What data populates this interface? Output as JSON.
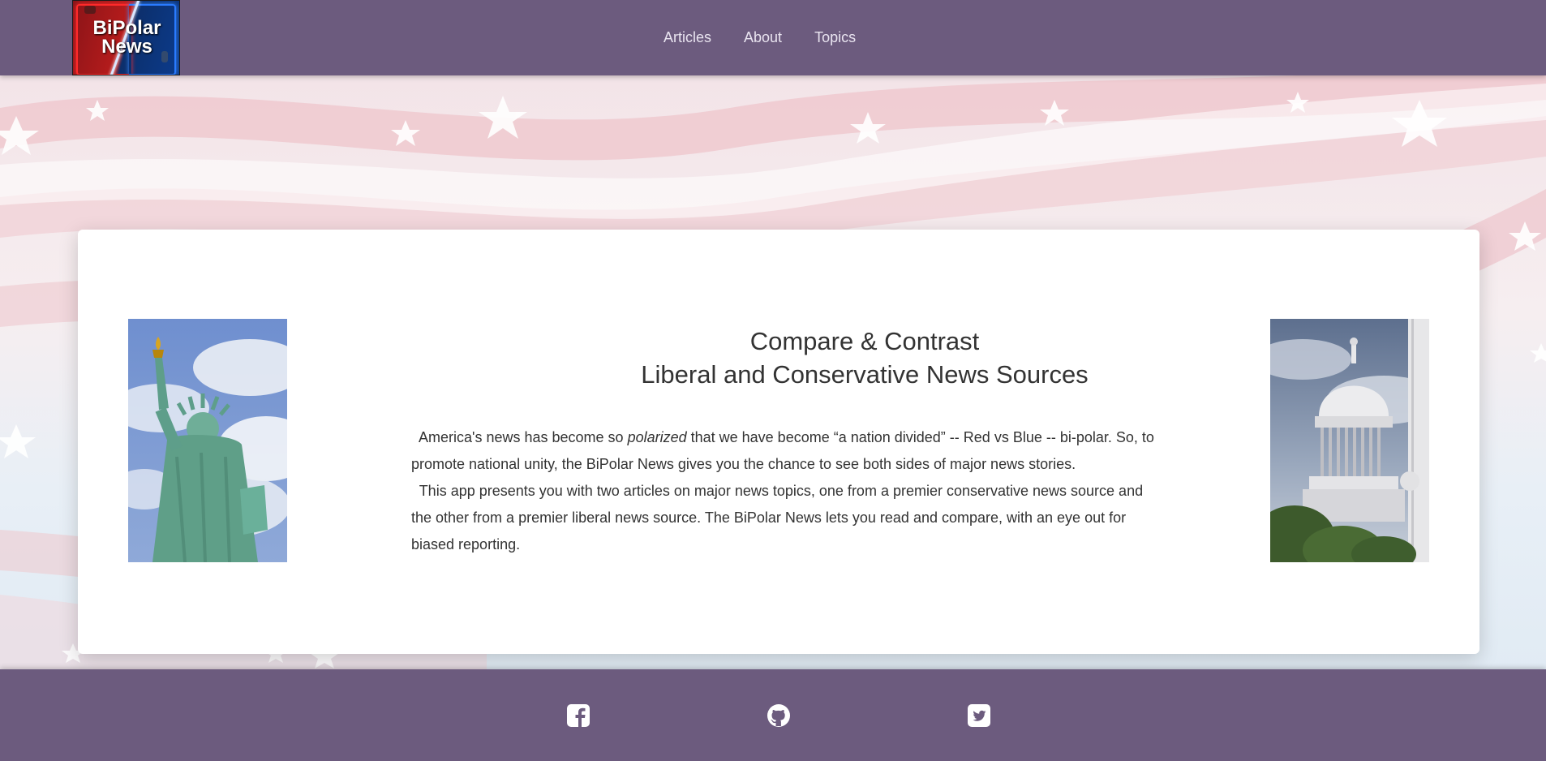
{
  "brand": {
    "logo_text_line1": "BiPolar",
    "logo_text_line2": "News"
  },
  "nav": {
    "items": [
      "Articles",
      "About",
      "Topics"
    ]
  },
  "hero": {
    "title_line1": "Compare & Contrast",
    "title_line2": "Liberal and Conservative News Sources",
    "para1_before": "America's news has become so ",
    "para1_emph": "polarized",
    "para1_after": " that we have become “a nation divided” -- Red vs Blue -- bi-polar. So, to promote national unity, the BiPolar News gives you the chance to see both sides of major news stories.",
    "para2": "This app presents you with two articles on major news topics, one from a premier conservative news source and the other from a premier liberal news source. The BiPolar News lets you read and compare, with an eye out for biased reporting."
  },
  "footer": {
    "icons": [
      "facebook-icon",
      "github-icon",
      "twitter-icon"
    ]
  },
  "colors": {
    "navbar": "#6c5b7e",
    "footer": "#6c5b7e",
    "card": "#ffffff",
    "text": "#333333"
  }
}
